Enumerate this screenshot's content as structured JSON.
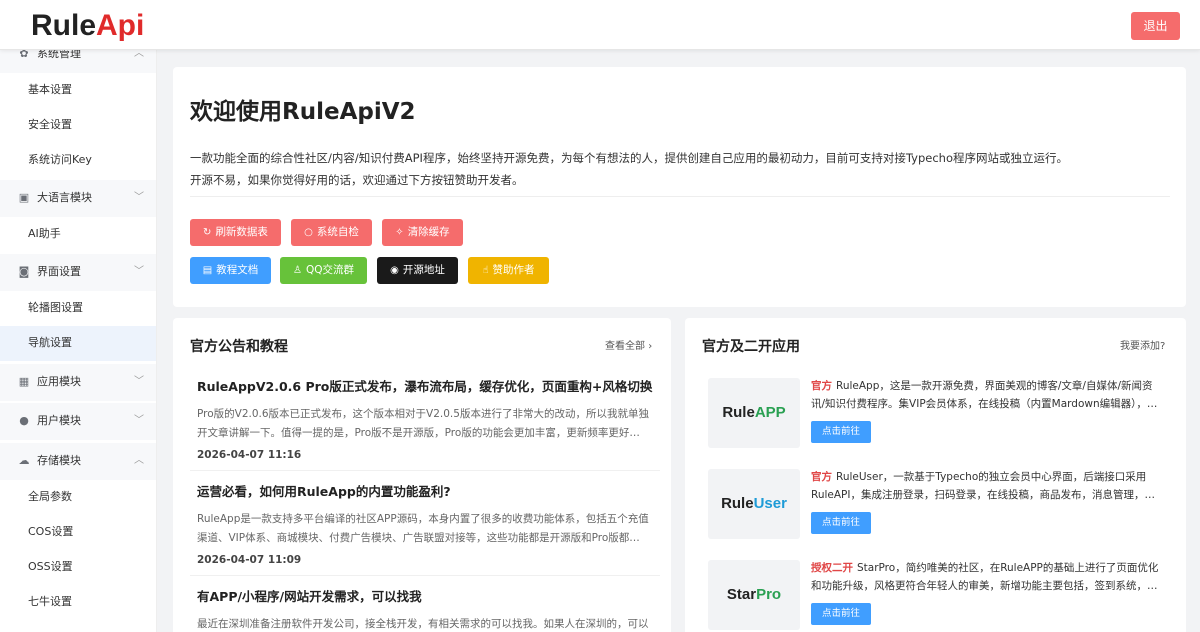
{
  "header": {
    "logo_part1": "Rule",
    "logo_part2": "Api",
    "logout_label": "退出"
  },
  "sidebar": {
    "groups": [
      {
        "label": "系统管理",
        "icon": "gear-icon",
        "items": [
          "基本设置",
          "安全设置",
          "系统访问Key"
        ]
      },
      {
        "label": "大语言模块",
        "icon": "clipboard-icon",
        "items": [
          "AI助手"
        ]
      },
      {
        "label": "界面设置",
        "icon": "camera-icon",
        "items": [
          "轮播图设置",
          "导航设置"
        ]
      },
      {
        "label": "应用模块",
        "icon": "grid-icon",
        "items": []
      },
      {
        "label": "用户模块",
        "icon": "user-icon",
        "items": []
      },
      {
        "label": "存储模块",
        "icon": "cloud-upload-icon",
        "items": [
          "全局参数",
          "COS设置",
          "OSS设置",
          "七牛设置"
        ]
      }
    ],
    "active_item": "导航设置"
  },
  "welcome": {
    "title": "欢迎使用RuleApiV2",
    "desc_line1": "一款功能全面的综合性社区/内容/知识付费API程序，始终坚持开源免费，为每个有想法的人，提供创建自己应用的最初动力，目前可支持对接Typecho程序网站或独立运行。",
    "desc_line2": "开源不易，如果你觉得好用的话，欢迎通过下方按钮赞助开发者。",
    "buttons_row1": [
      {
        "label": "刷新数据表",
        "icon": "refresh-icon",
        "color": "#f56c6c"
      },
      {
        "label": "系统自检",
        "icon": "loop-icon",
        "color": "#f56c6c"
      },
      {
        "label": "清除缓存",
        "icon": "broom-icon",
        "color": "#f56c6c"
      }
    ],
    "buttons_row2": [
      {
        "label": "教程文档",
        "icon": "document-icon",
        "color": "#409eff"
      },
      {
        "label": "QQ交流群",
        "icon": "user-icon",
        "color": "#67c23a"
      },
      {
        "label": "开源地址",
        "icon": "eye-icon",
        "color": "#1a1a1a"
      },
      {
        "label": "赞助作者",
        "icon": "thumb-icon",
        "color": "#f0b400"
      }
    ]
  },
  "news": {
    "title": "官方公告和教程",
    "view_all": "查看全部",
    "items": [
      {
        "title": "RuleAppV2.0.6 Pro版正式发布，瀑布流布局，缓存优化，页面重构+风格切换",
        "excerpt": "Pro版的V2.0.6版本已正式发布，这个版本相对于V2.0.5版本进行了非常大的改动，所以我就单独开文章讲解一下。值得一提的是，Pro版不是开源版，Pro版的功能会更加丰富，更新频率更好…",
        "date": "2026-04-07 11:16"
      },
      {
        "title": "运营必看，如何用RuleApp的内置功能盈利?",
        "excerpt": "RuleApp是一款支持多平台编译的社区APP源码，本身内置了很多的收费功能体系，包括五个充值渠道、VIP体系、商城模块、付费广告模块、广告联盟对接等，这些功能都是开源版和Pro版都…",
        "date": "2026-04-07 11:09"
      },
      {
        "title": "有APP/小程序/网站开发需求，可以找我",
        "excerpt": "最近在深圳准备注册软件开发公司，接全栈开发，有相关需求的可以找我。如果人在深圳的，可以",
        "date": ""
      }
    ]
  },
  "apps": {
    "title": "官方及二开应用",
    "add_link": "我要添加?",
    "go_label": "点击前往",
    "items": [
      {
        "logo1": "Rule",
        "logo2": "APP",
        "tag": "官方",
        "desc": "RuleApp，这是一款开源免费，界面美观的博客/文章/自媒体/新闻资讯/知识付费程序。集VIP会员体系，在线投稿（内置Mardown编辑器），…"
      },
      {
        "logo1": "Rule",
        "logo2": "User",
        "tag": "官方",
        "desc": "RuleUser，一款基于Typecho的独立会员中心界面，后端接口采用RuleAPI，集成注册登录，扫码登录，在线投稿，商品发布，消息管理，…"
      },
      {
        "logo1": "Star",
        "logo2": "Pro",
        "tag": "授权二开",
        "desc": "StarPro，简约唯美的社区，在RuleAPP的基础上进行了页面优化和功能升级，风格更符合年轻人的审美，新增功能主要包括，签到系统，…"
      }
    ]
  }
}
